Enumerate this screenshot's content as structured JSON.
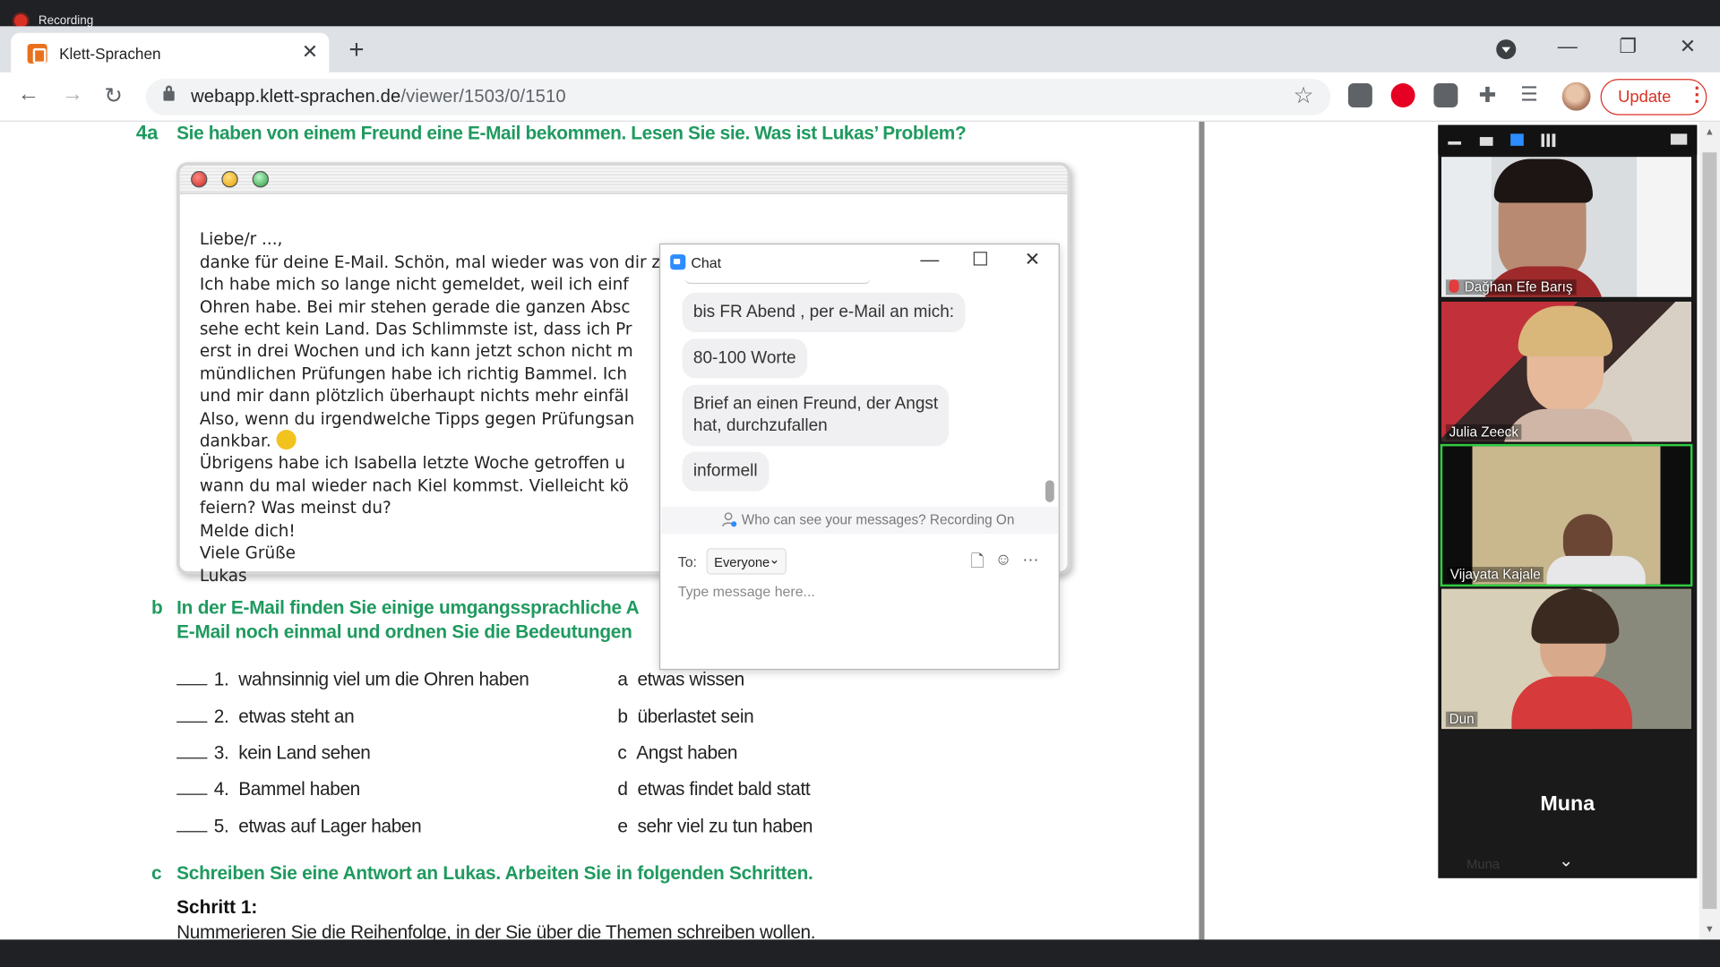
{
  "recording": {
    "label": "Recording"
  },
  "browser": {
    "tab_title": "Klett-Sprachen",
    "url_host": "webapp.klett-sprachen.de",
    "url_path": "/viewer/1503/0/1510",
    "update_label": "Update",
    "accent_color": "#d93025"
  },
  "page": {
    "ex4a_number": "4a",
    "ex4a_text": "Sie haben von einem Freund eine E-Mail bekommen. Lesen Sie sie. Was ist Lukas’ Problem?",
    "mail_lines": [
      "Liebe/r ...,",
      "danke für deine E-Mail. Schön, mal wieder was von dir zu hören.",
      "Ich habe mich so lange nicht gemeldet, weil ich einf",
      "Ohren habe. Bei mir stehen gerade die ganzen Absc",
      "sehe echt kein Land. Das Schlimmste ist, dass ich Pr",
      "erst in drei Wochen und ich kann jetzt schon nicht m",
      "mündlichen Prüfungen habe ich richtig Bammel. Ich",
      "und mir dann plötzlich überhaupt nichts mehr einfäl",
      "Also, wenn du irgendwelche Tipps gegen Prüfungsan",
      "dankbar.",
      "Übrigens habe ich Isabella letzte Woche getroffen u",
      "wann du mal wieder nach Kiel kommst. Vielleicht kö",
      "feiern? Was meinst du?",
      "Melde dich!",
      "Viele Grüße",
      "Lukas"
    ],
    "exb_label": "b",
    "exb_line1": "In der E-Mail finden Sie einige umgangssprachliche A",
    "exb_line2": "E-Mail noch einmal und ordnen Sie die Bedeutungen",
    "left_items": [
      {
        "num": "1.",
        "text": "wahnsinnig viel um die Ohren haben"
      },
      {
        "num": "2.",
        "text": "etwas steht an"
      },
      {
        "num": "3.",
        "text": "kein Land sehen"
      },
      {
        "num": "4.",
        "text": "Bammel haben"
      },
      {
        "num": "5.",
        "text": "etwas auf Lager haben"
      }
    ],
    "right_items": [
      {
        "letter": "a",
        "text": "etwas wissen"
      },
      {
        "letter": "b",
        "text": "überlastet sein"
      },
      {
        "letter": "c",
        "text": "Angst haben"
      },
      {
        "letter": "d",
        "text": "etwas findet bald statt"
      },
      {
        "letter": "e",
        "text": "sehr viel zu tun haben"
      }
    ],
    "exc_label": "c",
    "exc_text": "Schreiben Sie eine Antwort an Lukas. Arbeiten Sie in folgenden Schritten.",
    "schritt_title": "Schritt 1:",
    "schritt_text": "Nummerieren Sie die Reihenfolge, in der Sie über die Themen schreiben wollen."
  },
  "chat": {
    "title": "Chat",
    "messages": [
      "bis FR Abend , per e-Mail an mich:",
      "80-100 Worte",
      "Brief an einen Freund, der Angst\nhat, durchzufallen",
      "informell"
    ],
    "privacy_text": "Who can see your messages? Recording On",
    "to_label": "To:",
    "recipient": "Everyone",
    "input_placeholder": "Type message here..."
  },
  "gallery": {
    "participants": [
      {
        "name": "Dağhan Efe Barış",
        "muted": true
      },
      {
        "name": "Julia Zeeck",
        "muted": false
      },
      {
        "name": "Vijayata Kajale",
        "muted": false,
        "active_speaker": true
      },
      {
        "name": "Dun",
        "muted": false
      }
    ],
    "video_off_name": "Muna",
    "video_off_small_name": "Muna",
    "active_speaker_color": "#2ecc40"
  }
}
